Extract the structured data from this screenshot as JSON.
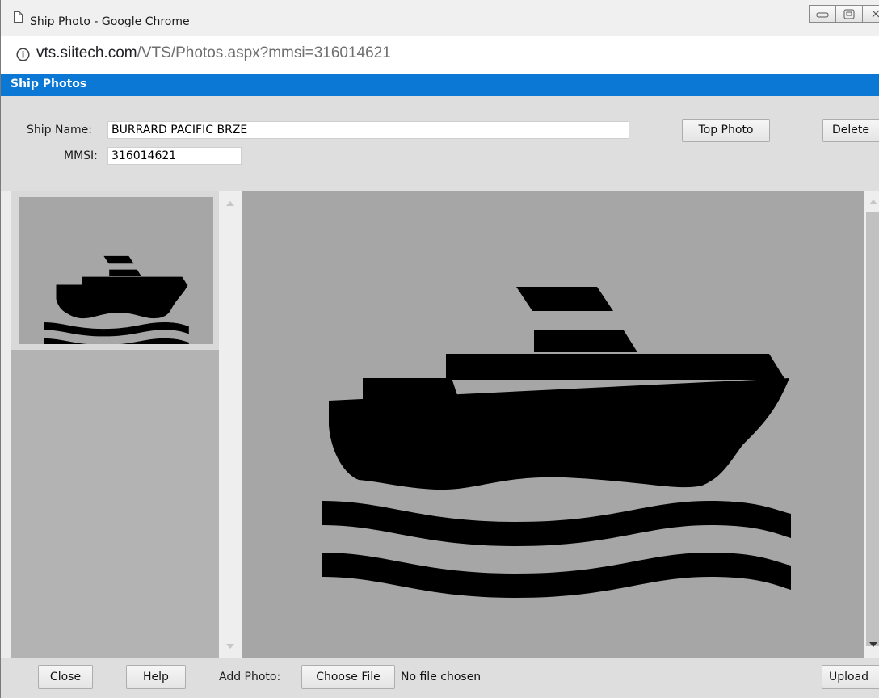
{
  "window": {
    "title": "Ship Photo - Google Chrome"
  },
  "address": {
    "host": "vts.siitech.com",
    "path": "/VTS/Photos.aspx?mmsi=316014621"
  },
  "header": {
    "title": "Ship Photos"
  },
  "form": {
    "ship_name_label": "Ship Name:",
    "ship_name_value": "BURRARD PACIFIC BRZE",
    "mmsi_label": "MMSI:",
    "mmsi_value": "316014621",
    "top_photo_label": "Top Photo",
    "delete_label": "Delete"
  },
  "footer": {
    "close_label": "Close",
    "help_label": "Help",
    "add_photo_label": "Add Photo:",
    "choose_file_label": "Choose File",
    "no_file_text": "No file chosen",
    "upload_label": "Upload"
  },
  "icons": {
    "page": "page-icon",
    "info": "info-icon",
    "ship": "ship-icon"
  },
  "colors": {
    "header_bar": "#0a78d4",
    "photo_background": "#a6a6a6"
  }
}
